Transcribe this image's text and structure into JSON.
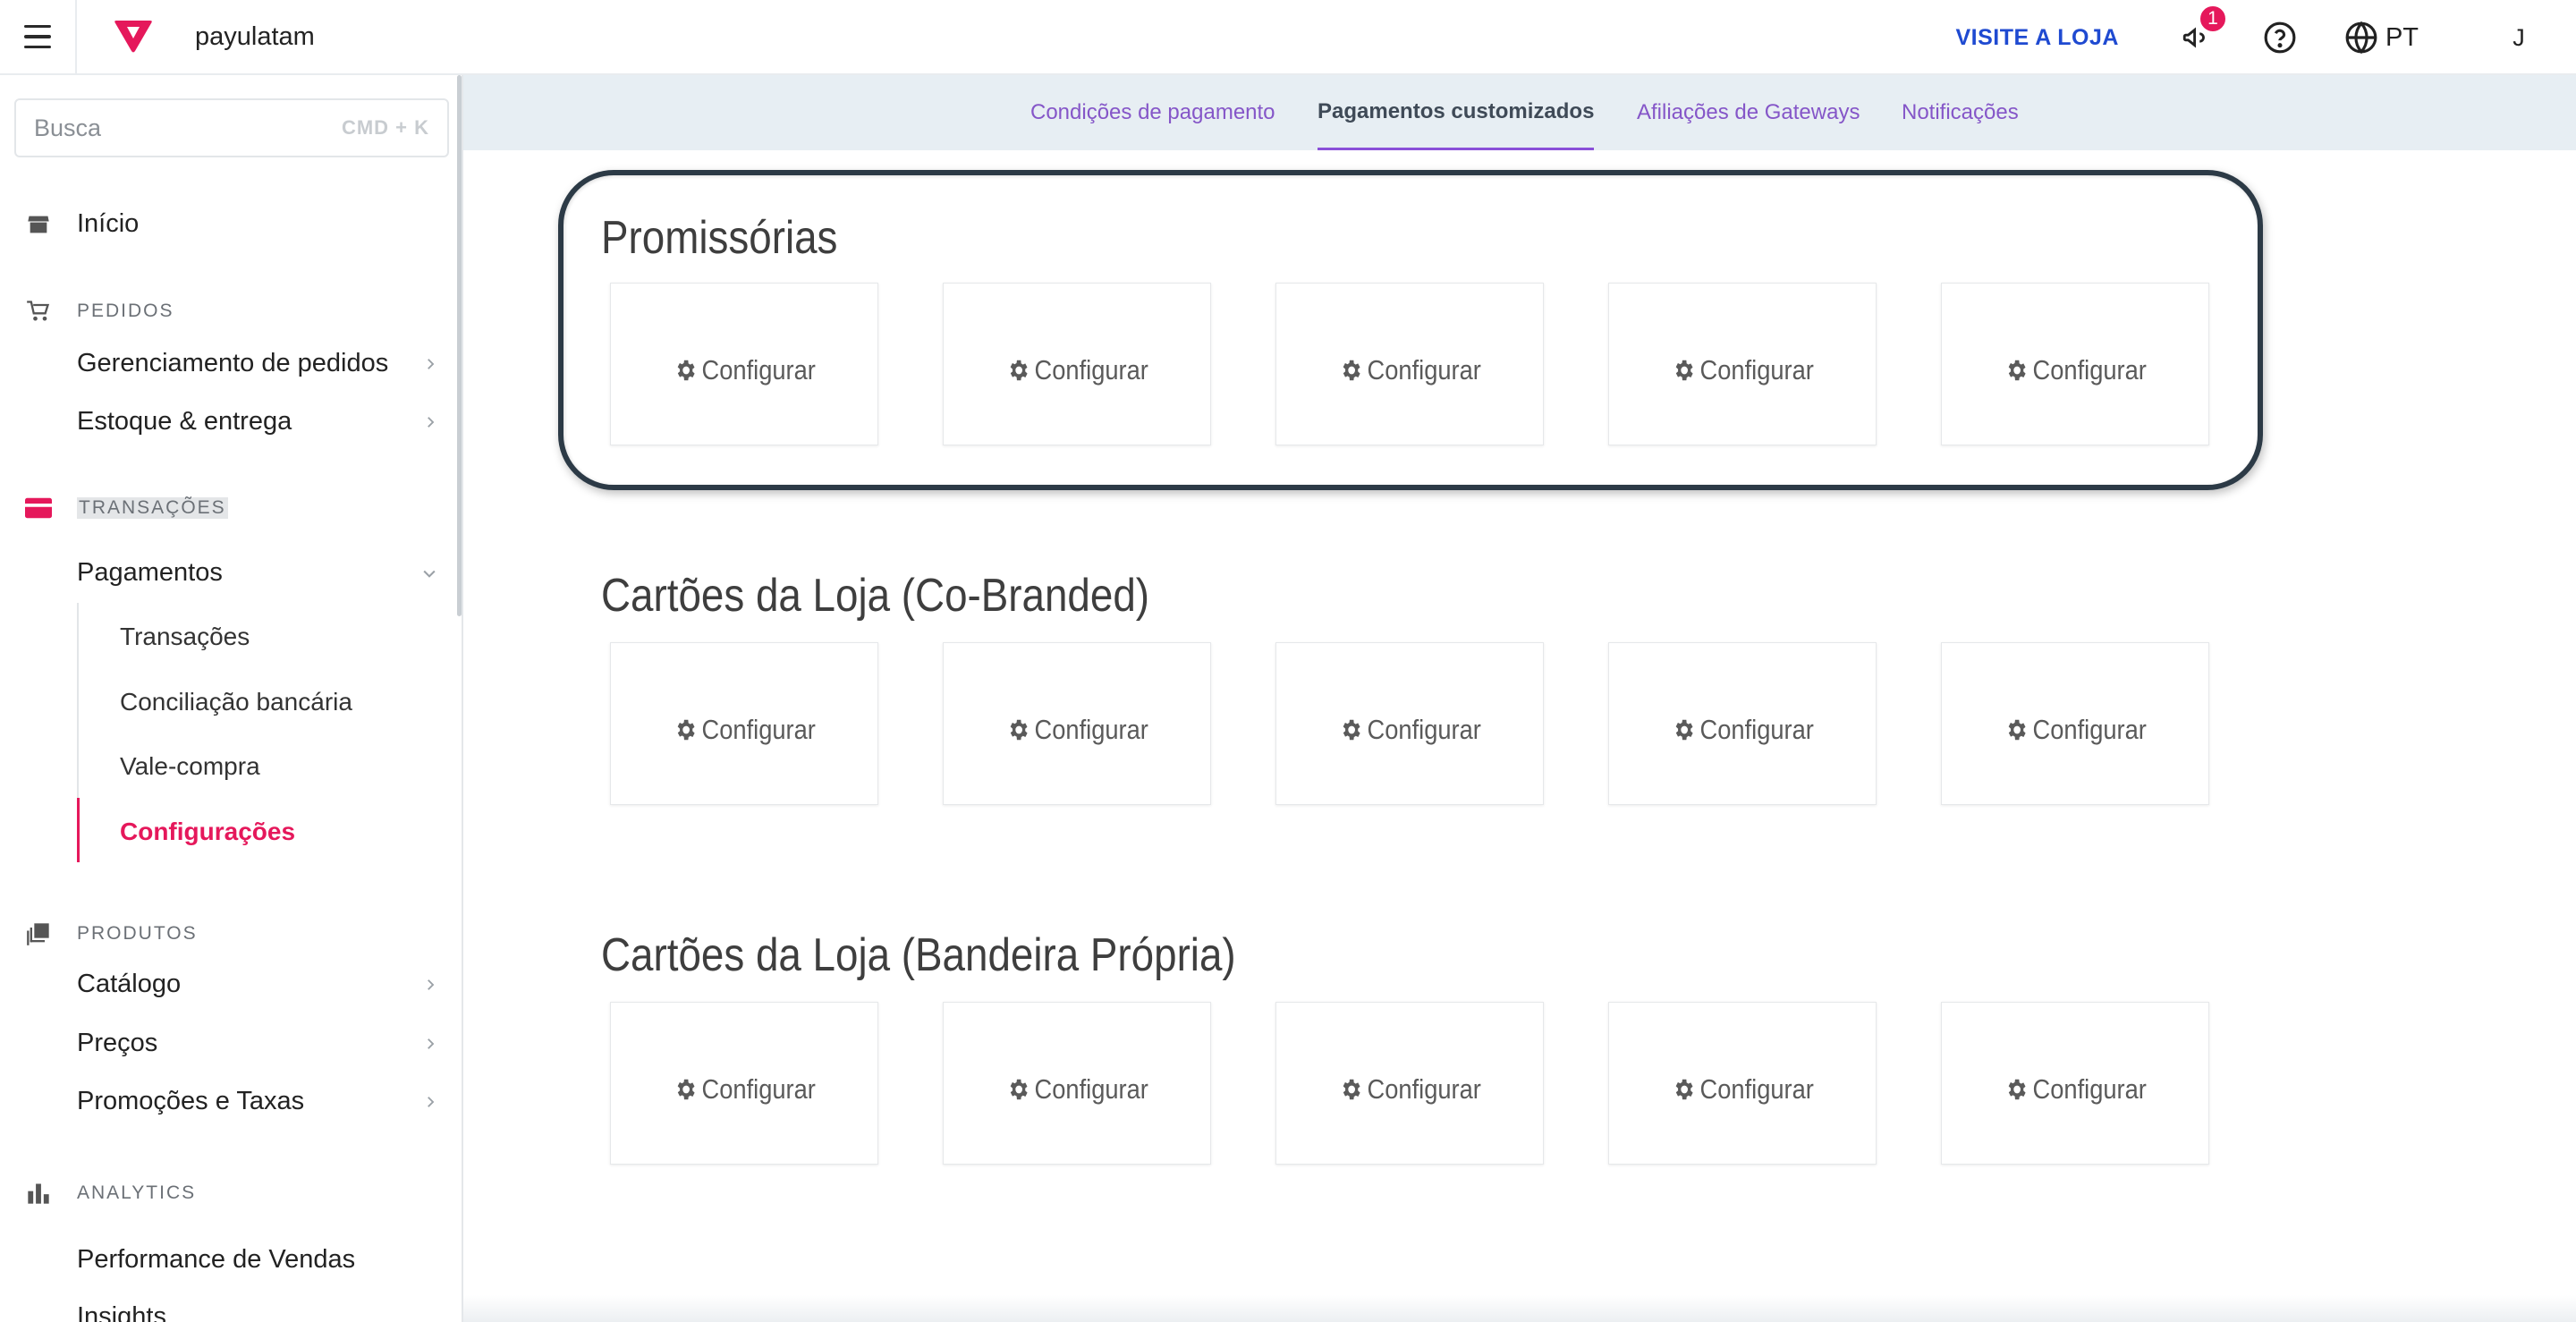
{
  "topbar": {
    "account": "payulatam",
    "visit_store": "VISITE A LOJA",
    "notifications_count": "1",
    "language": "PT",
    "avatar_initial": "J",
    "brand_color": "#e5185b"
  },
  "sidebar": {
    "search_placeholder": "Busca",
    "search_shortcut": "CMD + K",
    "home": "Início",
    "sections": {
      "orders": "PEDIDOS",
      "transactions": "TRANSAÇÕES",
      "products": "PRODUTOS",
      "analytics": "ANALYTICS"
    },
    "items": {
      "order_management": "Gerenciamento de pedidos",
      "inventory": "Estoque & entrega",
      "payments": "Pagamentos",
      "transactions": "Transações",
      "bank_reconciliation": "Conciliação bancária",
      "gift_card": "Vale-compra",
      "settings": "Configurações",
      "catalog": "Catálogo",
      "prices": "Preços",
      "promotions": "Promoções e Taxas",
      "sales_performance": "Performance de Vendas",
      "insights": "Insights"
    }
  },
  "tabs": [
    {
      "label": "Condições de pagamento"
    },
    {
      "label": "Pagamentos customizados"
    },
    {
      "label": "Afiliações de Gateways"
    },
    {
      "label": "Notificações"
    }
  ],
  "groups": [
    {
      "title": "Promissórias",
      "cards": [
        "Configurar",
        "Configurar",
        "Configurar",
        "Configurar",
        "Configurar"
      ]
    },
    {
      "title": "Cartões da Loja (Co-Branded)",
      "cards": [
        "Configurar",
        "Configurar",
        "Configurar",
        "Configurar",
        "Configurar"
      ]
    },
    {
      "title": "Cartões da Loja (Bandeira Própria)",
      "cards": [
        "Configurar",
        "Configurar",
        "Configurar",
        "Configurar",
        "Configurar"
      ]
    }
  ]
}
